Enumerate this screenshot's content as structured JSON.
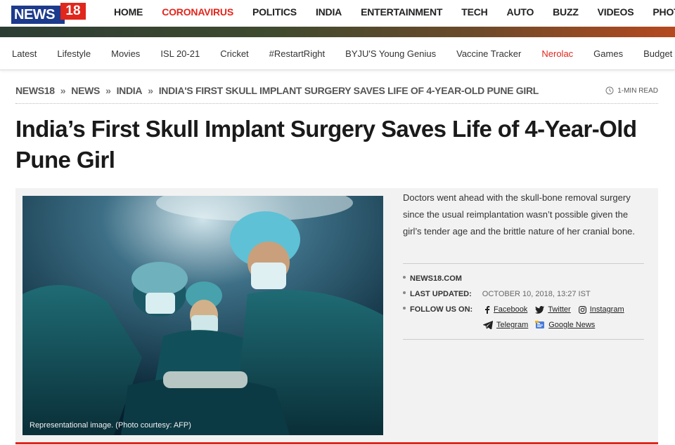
{
  "brand": {
    "logo_word": "NEWS",
    "logo_num": "18"
  },
  "main_nav": [
    "HOME",
    "CORONAVIRUS",
    "POLITICS",
    "INDIA",
    "ENTERTAINMENT",
    "TECH",
    "AUTO",
    "BUZZ",
    "VIDEOS",
    "PHOT"
  ],
  "sub_nav": [
    "Latest",
    "Lifestyle",
    "Movies",
    "ISL 20-21",
    "Cricket",
    "#RestartRight",
    "BYJU'S Young Genius",
    "Vaccine Tracker",
    "Nerolac",
    "Games",
    "Budget"
  ],
  "breadcrumb": [
    "NEWS18",
    "NEWS",
    "INDIA",
    "INDIA'S FIRST SKULL IMPLANT SURGERY SAVES LIFE OF 4-YEAR-OLD PUNE GIRL"
  ],
  "read_time": "1-MIN READ",
  "article": {
    "title": "India’s First Skull Implant Surgery Saves Life of 4-Year-Old Pune Girl",
    "caption": "Representational image. (Photo courtesy: AFP)",
    "summary": "Doctors went ahead with the skull-bone removal surgery since the usual reimplantation wasn’t possible given the girl’s tender age and the brittle nature of her cranial bone.",
    "source": "NEWS18.COM",
    "last_updated_label": "LAST UPDATED:",
    "last_updated_value": "OCTOBER 10, 2018, 13:27 IST",
    "follow_label": "FOLLOW US ON:",
    "social": {
      "facebook": "Facebook",
      "twitter": "Twitter",
      "instagram": "Instagram",
      "telegram": "Telegram",
      "google_news": "Google News"
    }
  },
  "colors": {
    "brand_red": "#e1261c",
    "brand_blue": "#1d3b8c"
  }
}
